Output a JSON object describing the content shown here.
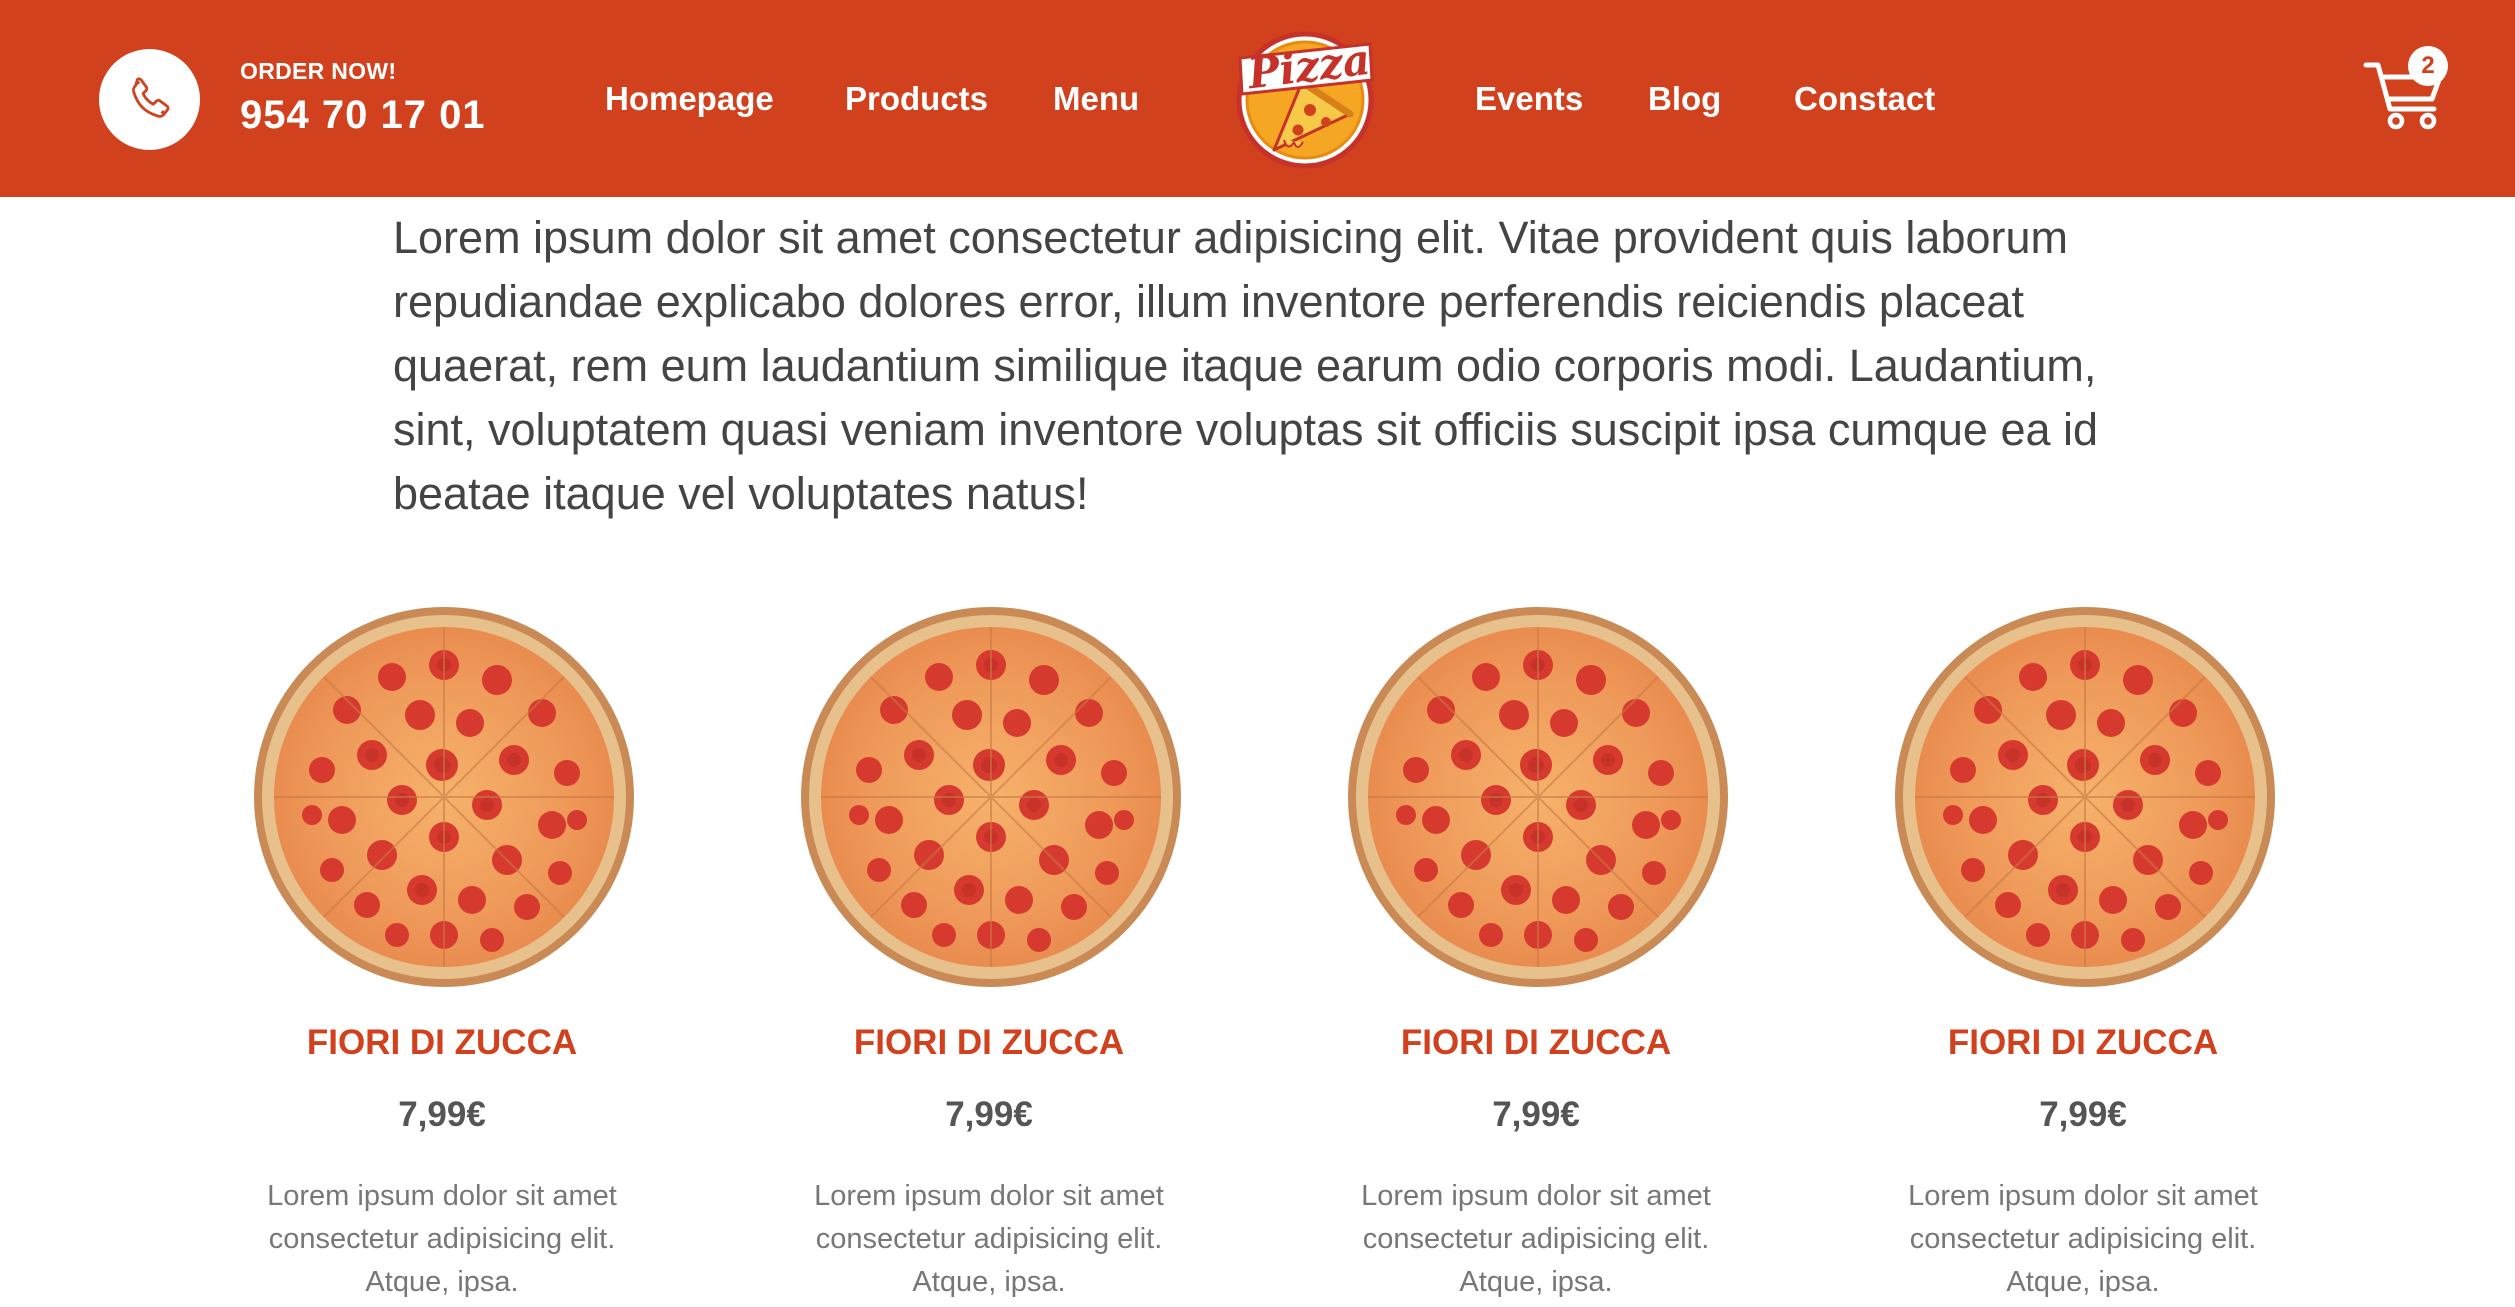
{
  "header": {
    "order_label": "ORDER NOW!",
    "phone_number": "954 70 17 01",
    "nav_left": [
      "Homepage",
      "Products",
      "Menu"
    ],
    "nav_right": [
      "Events",
      "Blog",
      "Constact"
    ],
    "logo_text": "Pizza",
    "cart_count": "2",
    "colors": {
      "bar": "#d1411e",
      "text": "#ffffff"
    },
    "icons": {
      "phone": "phone-icon",
      "cart": "cart-icon",
      "logo": "pizza-logo-icon"
    }
  },
  "intro": {
    "text": "Lorem ipsum dolor sit amet consectetur adipisicing elit. Vitae provident quis laborum repudiandae explicabo dolores error, illum inventore perferendis reiciendis placeat quaerat, rem eum laudantium similique itaque earum odio corporis modi. Laudantium, sint, voluptatem quasi veniam inventore voluptas sit officiis suscipit ipsa cumque ea id beatae itaque vel voluptates natus!"
  },
  "products": [
    {
      "title": "FIORI DI ZUCCA",
      "price": "7,99€",
      "description": "Lorem ipsum dolor sit amet consectetur adipisicing elit. Atque, ipsa."
    },
    {
      "title": "FIORI DI ZUCCA",
      "price": "7,99€",
      "description": "Lorem ipsum dolor sit amet consectetur adipisicing elit. Atque, ipsa."
    },
    {
      "title": "FIORI DI ZUCCA",
      "price": "7,99€",
      "description": "Lorem ipsum dolor sit amet consectetur adipisicing elit. Atque, ipsa."
    },
    {
      "title": "FIORI DI ZUCCA",
      "price": "7,99€",
      "description": "Lorem ipsum dolor sit amet consectetur adipisicing elit. Atque, ipsa."
    }
  ],
  "theme": {
    "accent": "#d1411e",
    "price_color": "#555555",
    "desc_color": "#777777"
  }
}
